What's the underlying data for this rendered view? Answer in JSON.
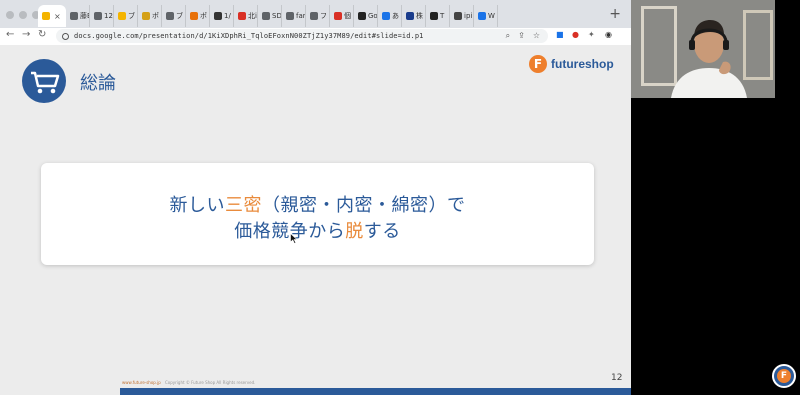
{
  "browser": {
    "tabs": [
      {
        "label": "",
        "color": "#f4b400",
        "active": true
      },
      {
        "label": "藤E",
        "color": "#5f6368"
      },
      {
        "label": "12/",
        "color": "#5f6368"
      },
      {
        "label": "ブ",
        "color": "#f4b400"
      },
      {
        "label": "ポ",
        "color": "#d4a017"
      },
      {
        "label": "ブ",
        "color": "#5f6368"
      },
      {
        "label": "ポ",
        "color": "#e8710a"
      },
      {
        "label": "1/",
        "color": "#333333"
      },
      {
        "label": "北i",
        "color": "#d93025"
      },
      {
        "label": "SD",
        "color": "#5f6368"
      },
      {
        "label": "far",
        "color": "#5f6368"
      },
      {
        "label": "フ",
        "color": "#5f6368"
      },
      {
        "label": "個",
        "color": "#d93025"
      },
      {
        "label": "Go",
        "color": "#222222"
      },
      {
        "label": "あ",
        "color": "#1a73e8"
      },
      {
        "label": "株",
        "color": "#1a3c8c"
      },
      {
        "label": "T",
        "color": "#222222"
      },
      {
        "label": "ipi",
        "color": "#444444"
      },
      {
        "label": "W",
        "color": "#1a73e8"
      }
    ],
    "new_tab": "+",
    "url": "docs.google.com/presentation/d/1KiXDphRi_TqloEFoxnN00ZTjZ1y37M89/edit#slide=id.p1"
  },
  "slide": {
    "section_title": "総論",
    "logo_letter": "F",
    "logo_text": "futureshop",
    "message_line1_a": "新しい",
    "message_line1_highlight": "三密",
    "message_line1_b": "（親密・内密・綿密）で",
    "message_line2_a": "価格競争から",
    "message_line2_highlight": "脱",
    "message_line2_b": "する",
    "footer_url": "www.future-shop.jp",
    "footer_copyright": "Copyright © Future Shop All Rights reserved.",
    "page_number": "12"
  },
  "colors": {
    "primary": "#2b5a99",
    "accent": "#e98b3c"
  },
  "corner_logo_letter": "F"
}
